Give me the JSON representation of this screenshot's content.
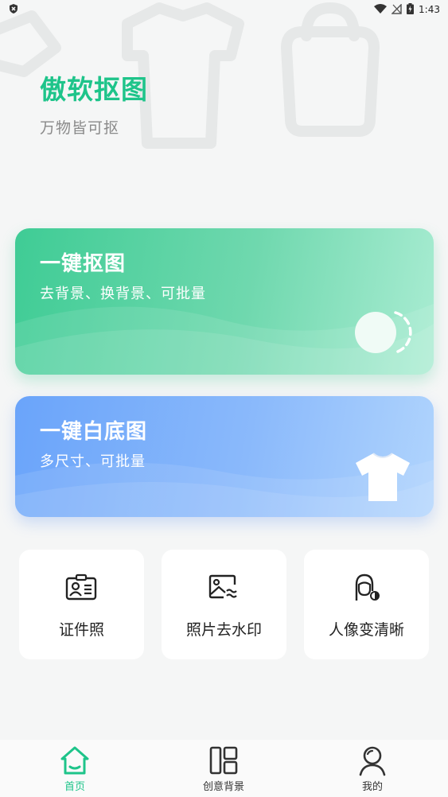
{
  "status_bar": {
    "time": "1:43",
    "left_icon": "shield-icon",
    "icons": [
      "wifi-icon",
      "signal-off-icon",
      "battery-charging-icon"
    ]
  },
  "header": {
    "title": "傲软抠图",
    "subtitle": "万物皆可抠"
  },
  "cards": {
    "cutout": {
      "title": "一键抠图",
      "subtitle": "去背景、换背景、可批量",
      "icon": "toggle-circle-icon"
    },
    "white_bg": {
      "title": "一键白底图",
      "subtitle": "多尺寸、可批量",
      "icon": "tshirt-icon"
    }
  },
  "tools": [
    {
      "label": "证件照",
      "icon": "id-card-icon"
    },
    {
      "label": "照片去水印",
      "icon": "image-watermark-icon"
    },
    {
      "label": "人像变清晰",
      "icon": "portrait-enhance-icon"
    }
  ],
  "tabs": [
    {
      "label": "首页",
      "icon": "home-icon",
      "active": true
    },
    {
      "label": "创意背景",
      "icon": "layout-icon",
      "active": false
    },
    {
      "label": "我的",
      "icon": "user-icon",
      "active": false
    }
  ],
  "colors": {
    "brand_green": "#1ec48a",
    "card_green": "#3fcc95",
    "card_blue": "#6aa4fa",
    "page_bg": "#f5f6f6"
  }
}
